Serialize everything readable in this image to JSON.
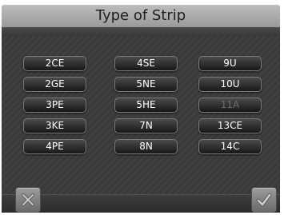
{
  "title": "Type of Strip",
  "strips": [
    {
      "label": "2CE",
      "enabled": true
    },
    {
      "label": "4SE",
      "enabled": true
    },
    {
      "label": "9U",
      "enabled": true
    },
    {
      "label": "2GE",
      "enabled": true
    },
    {
      "label": "5NE",
      "enabled": true
    },
    {
      "label": "10U",
      "enabled": true
    },
    {
      "label": "3PE",
      "enabled": true
    },
    {
      "label": "5HE",
      "enabled": true
    },
    {
      "label": "11A",
      "enabled": false
    },
    {
      "label": "3KE",
      "enabled": true
    },
    {
      "label": "7N",
      "enabled": true
    },
    {
      "label": "13CE",
      "enabled": true
    },
    {
      "label": "4PE",
      "enabled": true
    },
    {
      "label": "8N",
      "enabled": true
    },
    {
      "label": "14C",
      "enabled": true
    }
  ],
  "icons": {
    "cancel": "close-icon",
    "confirm": "checkmark-icon"
  }
}
